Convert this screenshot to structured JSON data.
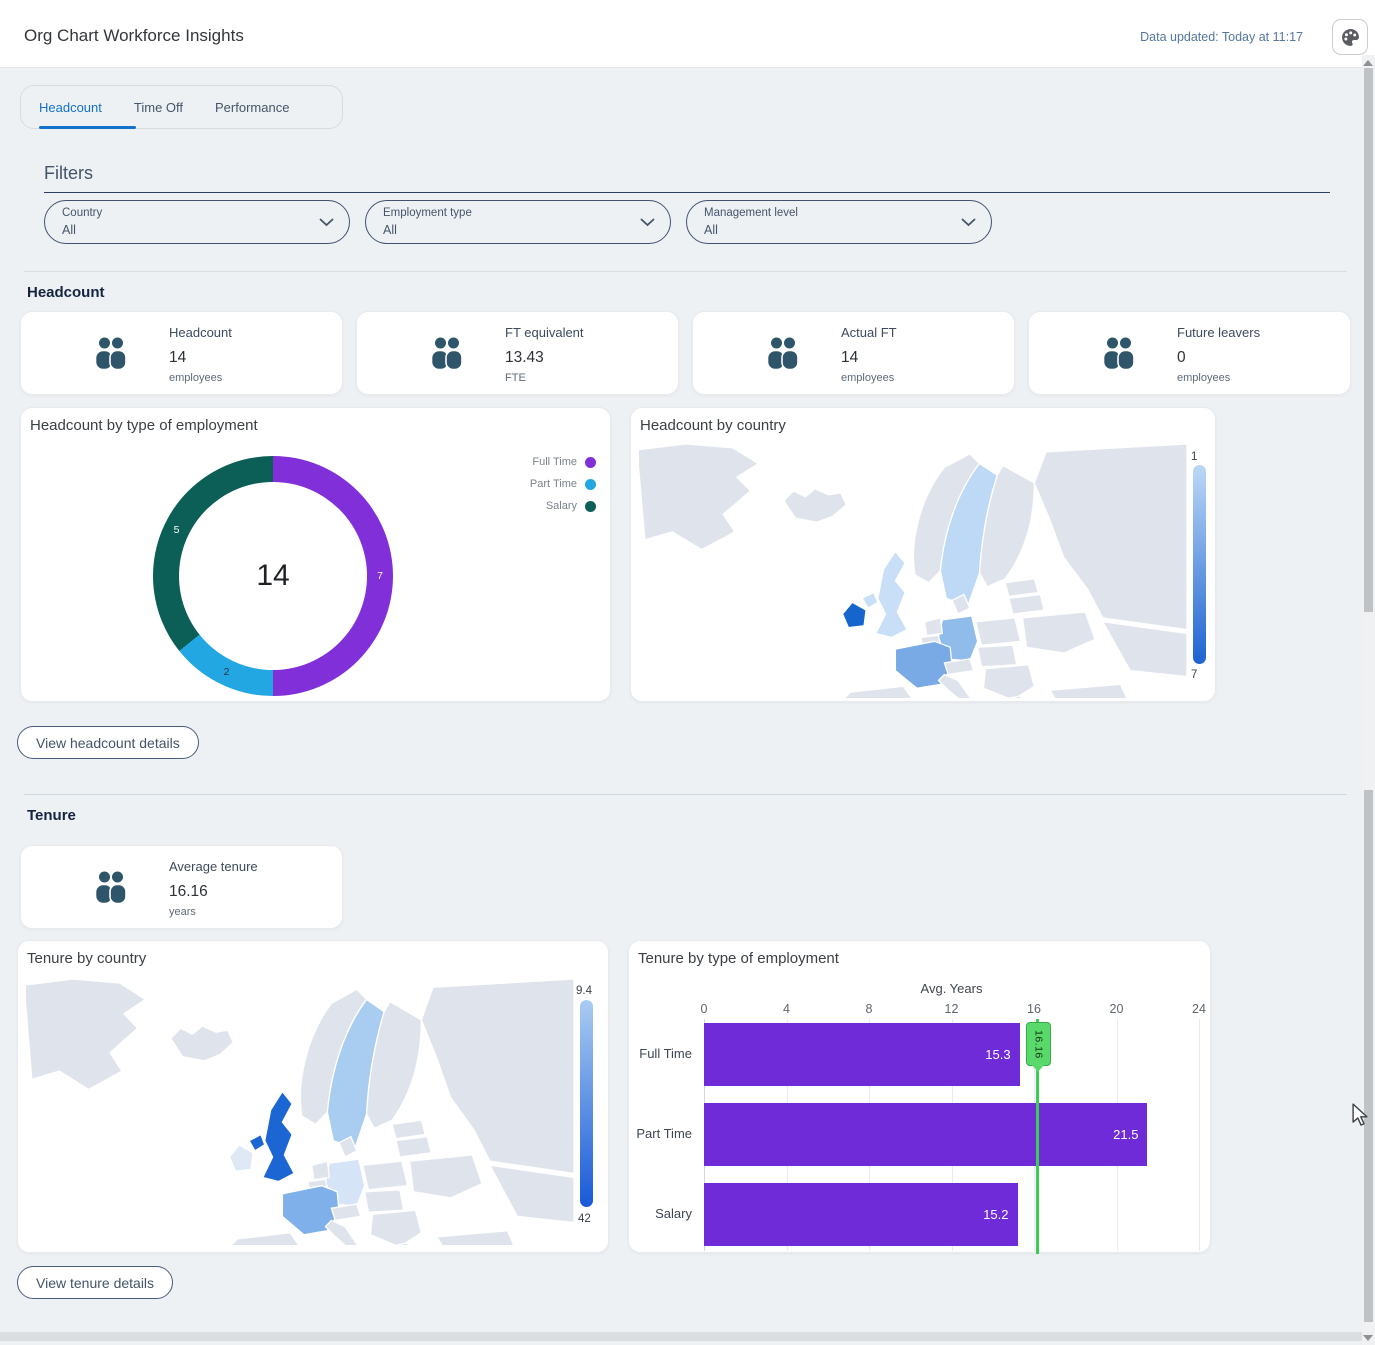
{
  "header": {
    "title": "Org Chart Workforce Insights",
    "data_updated": "Data updated: Today at 11:17"
  },
  "tabs": [
    {
      "label": "Headcount",
      "active": true
    },
    {
      "label": "Time Off",
      "active": false
    },
    {
      "label": "Performance",
      "active": false
    }
  ],
  "filters": {
    "heading": "Filters",
    "dropdowns": [
      {
        "label": "Country",
        "value": "All"
      },
      {
        "label": "Employment type",
        "value": "All"
      },
      {
        "label": "Management level",
        "value": "All"
      }
    ]
  },
  "headcount_section": {
    "heading": "Headcount",
    "kpis": [
      {
        "label": "Headcount",
        "value": "14",
        "unit": "employees"
      },
      {
        "label": "FT equivalent",
        "value": "13.43",
        "unit": "FTE"
      },
      {
        "label": "Actual FT",
        "value": "14",
        "unit": "employees"
      },
      {
        "label": "Future leavers",
        "value": "0",
        "unit": "employees"
      }
    ],
    "details_button": "View headcount details"
  },
  "tenure_section": {
    "heading": "Tenure",
    "kpis": [
      {
        "label": "Average tenure",
        "value": "16.16",
        "unit": "years"
      }
    ],
    "details_button": "View tenure details"
  },
  "chart_data": [
    {
      "type": "pie",
      "variant": "donut",
      "title": "Headcount by type of employment",
      "center_label": "14",
      "categories": [
        "Full Time",
        "Part Time",
        "Salary"
      ],
      "values": [
        7,
        2,
        5
      ],
      "colors": [
        "#812fd8",
        "#22a7e2",
        "#0b5f57"
      ],
      "label_colors": [
        "#ffffff",
        "#273648",
        "#ffffff"
      ],
      "legend_position": "top-right"
    },
    {
      "type": "choropleth",
      "title": "Headcount by country",
      "scale": {
        "top_label": "1",
        "bottom_label": "7",
        "light": "#bcd8f7",
        "dark": "#1d63d0"
      },
      "base_color": "#dfe4ec",
      "countries": [
        {
          "name": "Ireland",
          "value": 7,
          "color": "#1565cd"
        },
        {
          "name": "France",
          "value": 3,
          "color": "#79aae6"
        },
        {
          "name": "Germany",
          "value": 2,
          "color": "#90bcec"
        },
        {
          "name": "Sweden",
          "value": 1,
          "color": "#bed9f6"
        },
        {
          "name": "United Kingdom",
          "value": 1,
          "color": "#c9def7"
        }
      ]
    },
    {
      "type": "choropleth",
      "title": "Tenure by country",
      "scale": {
        "top_label": "9.4",
        "bottom_label": "42",
        "light": "#a9ccf2",
        "dark": "#1859d6"
      },
      "base_color": "#dfe4ec",
      "countries": [
        {
          "name": "United Kingdom",
          "value": 42,
          "color": "#1b66d2"
        },
        {
          "name": "France",
          "value": 24,
          "color": "#7fb0e9"
        },
        {
          "name": "Sweden",
          "value": 20,
          "color": "#a9cdf1"
        },
        {
          "name": "Germany",
          "value": 12,
          "color": "#d6e4f8"
        },
        {
          "name": "Ireland",
          "value": 9.4,
          "color": "#dfe9f6"
        }
      ]
    },
    {
      "type": "bar",
      "orientation": "horizontal",
      "title": "Tenure by type of employment",
      "axis_title": "Avg. Years",
      "categories": [
        "Full Time",
        "Part Time",
        "Salary"
      ],
      "values": [
        15.3,
        21.5,
        15.2
      ],
      "value_labels": [
        "15.3",
        "21.5",
        "15.2"
      ],
      "xlim": [
        0,
        24
      ],
      "ticks": [
        0,
        4,
        8,
        12,
        16,
        20,
        24
      ],
      "bar_color": "#6f2bd8",
      "grid": true,
      "reference_line": {
        "value": 16.16,
        "label": "16.16",
        "line_color": "#3ccd54",
        "flag_color": "#58d969",
        "flag_border": "#33ae4a"
      }
    }
  ]
}
